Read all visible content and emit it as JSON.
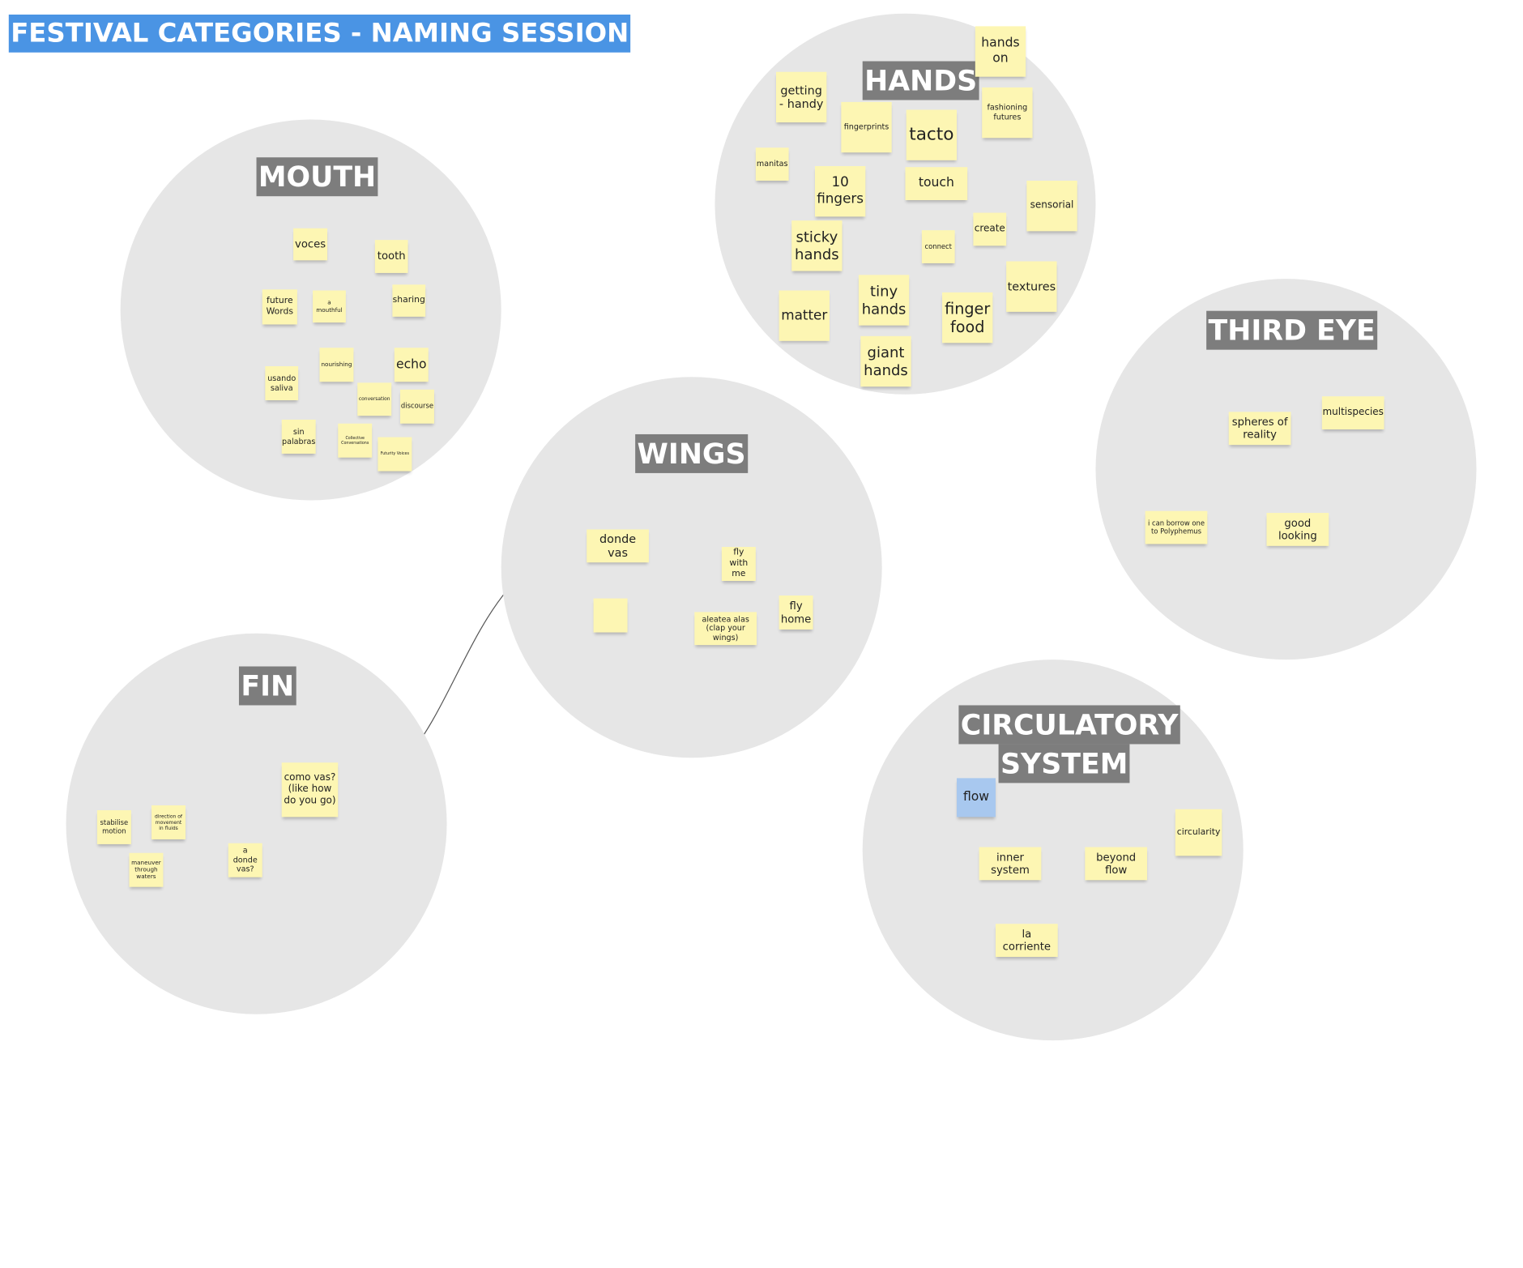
{
  "board": {
    "title": "FESTIVAL CATEGORIES - NAMING SESSION"
  },
  "categories": {
    "mouth": {
      "label": "MOUTH"
    },
    "hands": {
      "label": "HANDS"
    },
    "third_eye": {
      "label": "THIRD EYE"
    },
    "wings": {
      "label": "WINGS"
    },
    "fin": {
      "label": "FIN"
    },
    "circulatory": {
      "label_line1": "CIRCULATORY",
      "label_line2": "SYSTEM"
    }
  },
  "notes": {
    "mouth": [
      "voces",
      "tooth",
      "future Words",
      "a mouthful",
      "sharing",
      "nourishing",
      "echo",
      "usando saliva",
      "conversation",
      "discourse",
      "sin palabras",
      "Collective Conversations",
      "Futurity Voices"
    ],
    "hands": [
      "hands on",
      "getting - handy",
      "fingerprints",
      "tacto",
      "fashioning futures",
      "manitas",
      "10 fingers",
      "touch",
      "sensorial",
      "sticky hands",
      "connect",
      "create",
      "textures",
      "matter",
      "tiny hands",
      "finger food",
      "giant hands"
    ],
    "third_eye": [
      "spheres of reality",
      "multispecies",
      "i can borrow one to Polyphemus",
      "good looking"
    ],
    "wings": [
      "donde vas",
      "fly with me",
      "",
      "aleatea alas (clap your wings)",
      "fly home"
    ],
    "fin": [
      "como vas? (like how do you go)",
      "stabilise motion",
      "direction of movement in fluids",
      "maneuver through waters",
      "a donde vas?"
    ],
    "circulatory": [
      "flow",
      "circularity",
      "inner system",
      "beyond flow",
      "la corriente"
    ]
  },
  "colors": {
    "title_bg": "#4a94e4",
    "label_bg": "#7d7d7d",
    "circle_bg": "#e6e6e6",
    "sticky_yellow": "#fdf6b3",
    "sticky_blue": "#a8c8ef"
  }
}
